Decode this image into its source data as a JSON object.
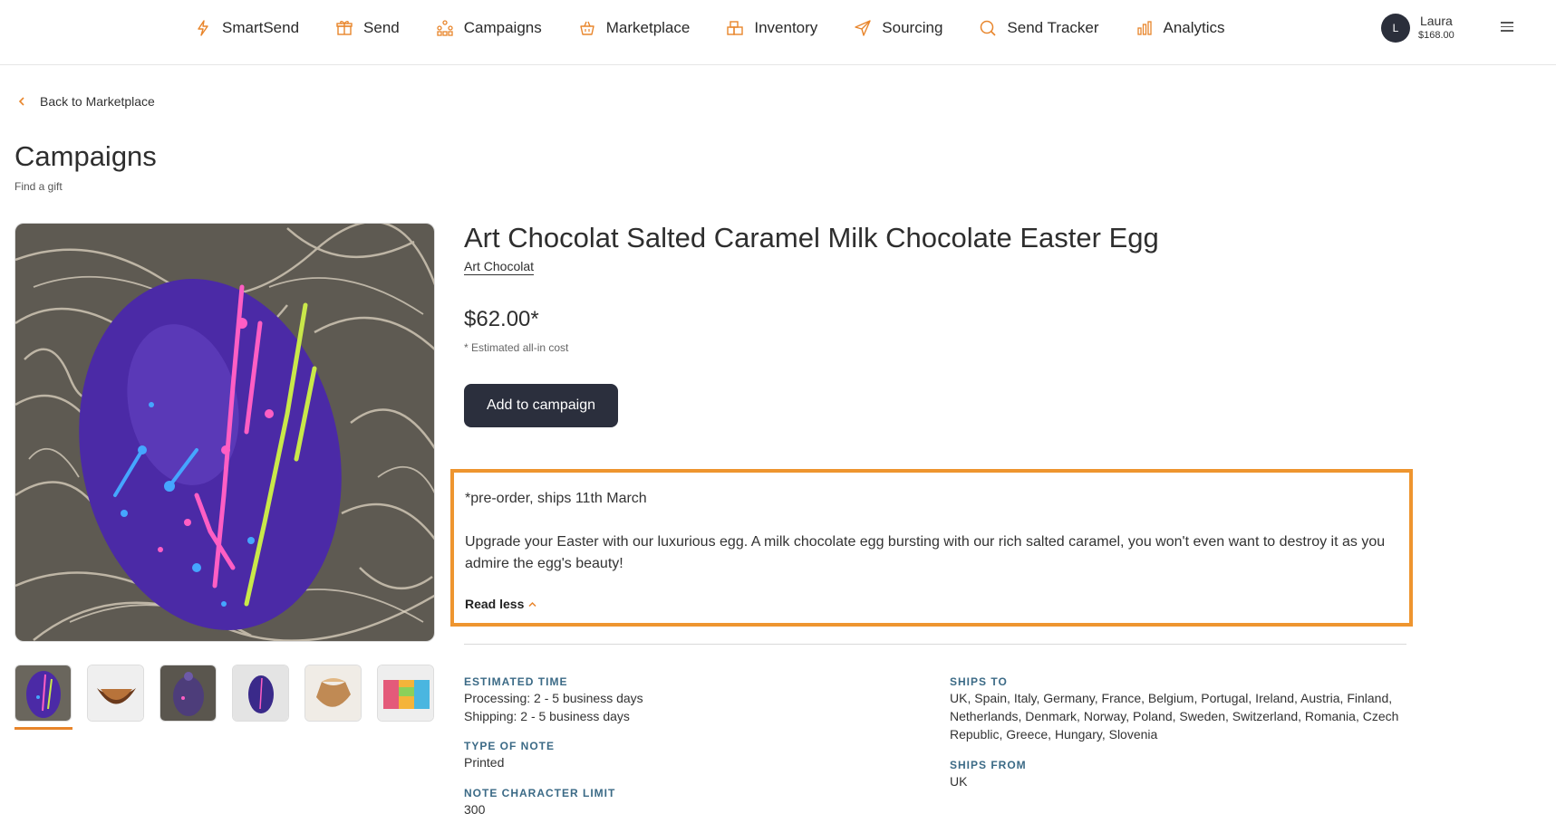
{
  "nav": {
    "items": [
      {
        "label": "SmartSend",
        "icon": "lightning-icon"
      },
      {
        "label": "Send",
        "icon": "gift-icon"
      },
      {
        "label": "Campaigns",
        "icon": "campaigns-icon"
      },
      {
        "label": "Marketplace",
        "icon": "basket-icon"
      },
      {
        "label": "Inventory",
        "icon": "boxes-icon"
      },
      {
        "label": "Sourcing",
        "icon": "paper-plane-icon"
      },
      {
        "label": "Send Tracker",
        "icon": "search-icon"
      },
      {
        "label": "Analytics",
        "icon": "bar-chart-icon"
      }
    ]
  },
  "user": {
    "initial": "L",
    "name": "Laura",
    "balance": "$168.00"
  },
  "back_link": "Back to Marketplace",
  "page": {
    "title": "Campaigns",
    "subtitle": "Find a gift"
  },
  "product": {
    "title": "Art Chocolat Salted Caramel Milk Chocolate Easter Egg",
    "brand": "Art Chocolat",
    "price": "$62.00*",
    "price_note": "* Estimated all-in cost",
    "add_button": "Add to campaign",
    "description_line": "*pre-order, ships 11th March",
    "description": "Upgrade your Easter with our luxurious egg. A milk chocolate egg bursting with our rich salted caramel, you won't even want to destroy it as you admire the egg's beauty!",
    "read_less": "Read less"
  },
  "specs": {
    "estimated_time_label": "ESTIMATED TIME",
    "processing": "Processing: 2 - 5 business days",
    "shipping": "Shipping: 2 - 5 business days",
    "note_type_label": "TYPE OF NOTE",
    "note_type": "Printed",
    "char_limit_label": "NOTE CHARACTER LIMIT",
    "char_limit": "300",
    "ships_to_label": "SHIPS TO",
    "ships_to": "UK, Spain, Italy, Germany, France, Belgium, Portugal, Ireland, Austria, Finland, Netherlands, Denmark, Norway, Poland, Sweden, Switzerland, Romania, Czech Republic, Greece, Hungary, Slovenia",
    "ships_from_label": "SHIPS FROM",
    "ships_from": "UK"
  },
  "colors": {
    "accent": "#e8852b",
    "button_dark": "#2b2f3d",
    "spec_label": "#3b6a86",
    "highlight": "#ee952f"
  }
}
